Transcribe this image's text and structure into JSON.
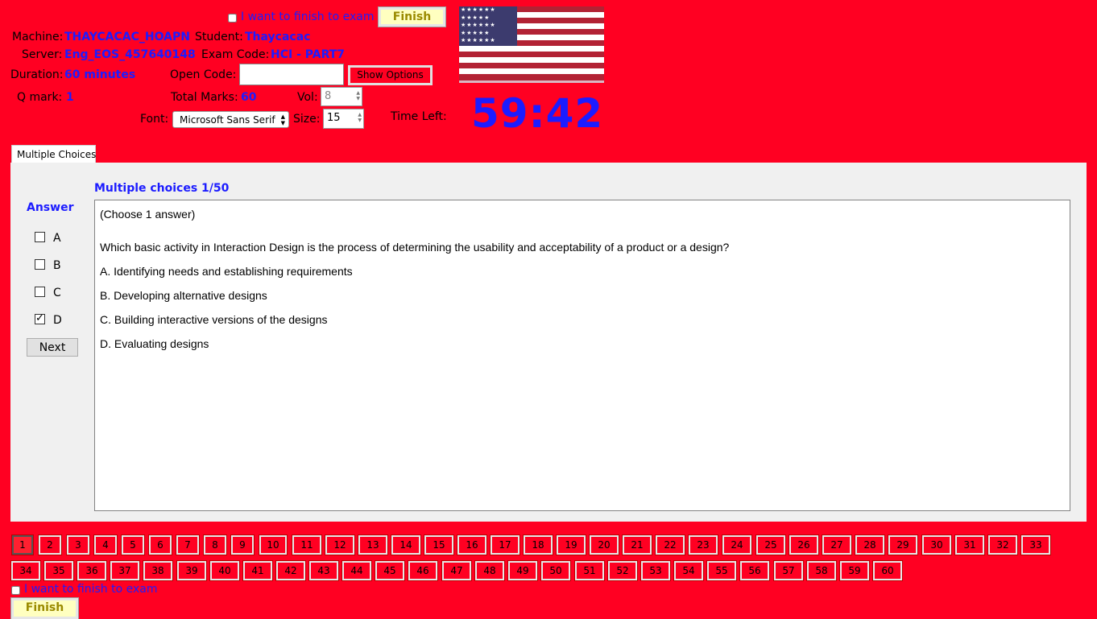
{
  "top": {
    "finish_checkbox_label": "I want to finish to exam",
    "finish_button": "Finish",
    "machine_label": "Machine:",
    "machine_value": "THAYCACAC_HOAPN",
    "student_label": "Student:",
    "student_value": "Thaycacac",
    "server_label": "Server:",
    "server_value": "Eng_EOS_457640148",
    "exam_code_label": "Exam Code:",
    "exam_code_value": "HCI - PART7",
    "duration_label": "Duration:",
    "duration_value": "60 minutes",
    "open_code_label": "Open Code:",
    "open_code_value": "",
    "show_options": "Show Options",
    "qmark_label": "Q mark:",
    "qmark_value": "1",
    "total_marks_label": "Total Marks:",
    "total_marks_value": "60",
    "vol_label": "Vol:",
    "vol_value": "8",
    "font_label": "Font:",
    "font_value": "Microsoft Sans Serif",
    "size_label": "Size:",
    "size_value": "15",
    "time_left_label": "Time Left:",
    "time_left_value": "59:42",
    "flag_icon": "us-flag-icon"
  },
  "tab": {
    "label": "Multiple Choices"
  },
  "question": {
    "header": "Multiple choices 1/50",
    "instruction": "(Choose 1 answer)",
    "text": "Which basic activity in Interaction Design is the process of determining the usability and acceptability of a product or a design?",
    "options": [
      "A. Identifying needs and establishing requirements",
      "B. Developing alternative designs",
      "C. Building interactive versions of the designs",
      "D. Evaluating designs"
    ]
  },
  "answer": {
    "title": "Answer",
    "choices": [
      {
        "label": "A",
        "checked": false
      },
      {
        "label": "B",
        "checked": false
      },
      {
        "label": "C",
        "checked": false
      },
      {
        "label": "D",
        "checked": true
      }
    ],
    "next_button": "Next"
  },
  "nav": {
    "numbers": [
      "1",
      "2",
      "3",
      "4",
      "5",
      "6",
      "7",
      "8",
      "9",
      "10",
      "11",
      "12",
      "13",
      "14",
      "15",
      "16",
      "17",
      "18",
      "19",
      "20",
      "21",
      "22",
      "23",
      "24",
      "25",
      "26",
      "27",
      "28",
      "29",
      "30",
      "31",
      "32",
      "33",
      "34",
      "35",
      "36",
      "37",
      "38",
      "39",
      "40",
      "41",
      "42",
      "43",
      "44",
      "45",
      "46",
      "47",
      "48",
      "49",
      "50",
      "51",
      "52",
      "53",
      "54",
      "55",
      "56",
      "57",
      "58",
      "59",
      "60"
    ],
    "current": "1"
  },
  "bottom": {
    "finish_checkbox_label": "I want to finish to exam",
    "finish_button": "Finish"
  },
  "colors": {
    "background": "#ff0022",
    "accent_blue": "#1c1cff"
  }
}
